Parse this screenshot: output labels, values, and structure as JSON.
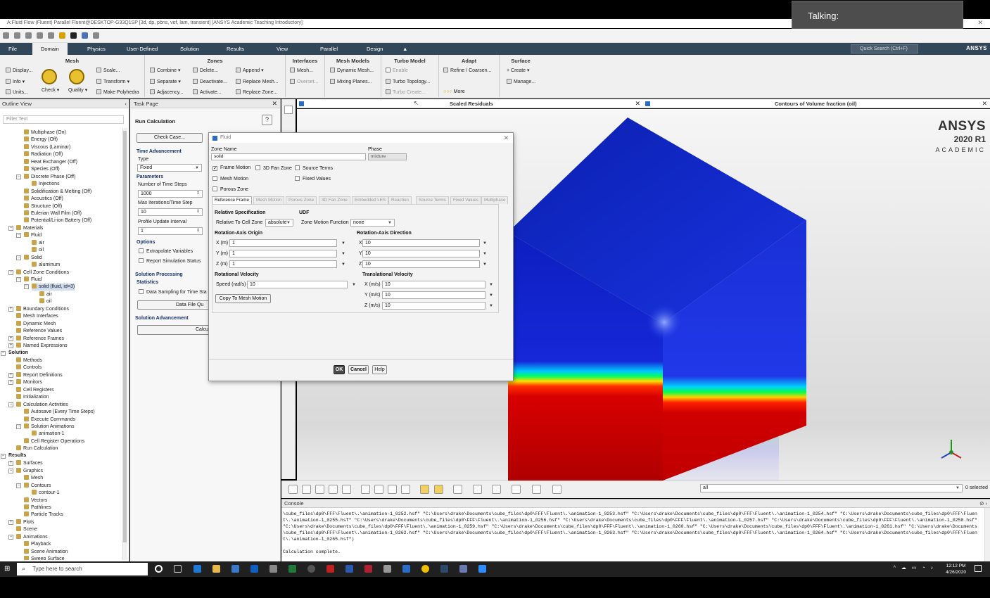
{
  "talking": "Talking:",
  "window_title": "A:Fluid Flow (Fluent) Parallel Fluent@DESKTOP-G33Q1SP  [3d, dp, pbns, vof, lam, transient] [ANSYS Academic Teaching Introductory]",
  "menu": {
    "file": "File",
    "domain": "Domain",
    "physics": "Physics",
    "user_defined": "User-Defined",
    "solution": "Solution",
    "results": "Results",
    "view": "View",
    "parallel": "Parallel",
    "design": "Design"
  },
  "quick_search": "Quick Search (Ctrl+F)",
  "ansys_logo": "ANSYS",
  "ribbon": {
    "mesh_title": "Mesh",
    "display": "Display...",
    "info": "Info",
    "units": "Units...",
    "check": "Check",
    "quality": "Quality",
    "scale": "Scale...",
    "transform": "Transform",
    "make_polyhedra": "Make Polyhedra",
    "zones_title": "Zones",
    "combine": "Combine",
    "separate": "Separate",
    "adjacency": "Adjacency...",
    "delete": "Delete...",
    "deactivate": "Deactivate...",
    "activate": "Activate...",
    "append": "Append",
    "replace_mesh": "Replace Mesh...",
    "replace_zone": "Replace Zone...",
    "interfaces_title": "Interfaces",
    "interfaces_mesh": "Mesh...",
    "overset": "Overset...",
    "mesh_models_title": "Mesh Models",
    "dynamic_mesh": "Dynamic Mesh...",
    "mixing_planes": "Mixing Planes...",
    "turbo_title": "Turbo Model",
    "enable": "Enable",
    "turbo_topology": "Turbo Topology...",
    "turbo_create": "Turbo Create...",
    "adapt_title": "Adapt",
    "refine_coarsen": "Refine / Coarsen...",
    "more": "More",
    "surface_title": "Surface",
    "create": "Create",
    "manage": "Manage..."
  },
  "outline": {
    "title": "Outline View",
    "filter_placeholder": "Filter Text",
    "items": [
      "Multiphase (On)",
      "Energy (Off)",
      "Viscous (Laminar)",
      "Radiation (Off)",
      "Heat Exchanger (Off)",
      "Species (Off)",
      "Discrete Phase (Off)",
      "Injections",
      "Solidification & Melting (Off)",
      "Acoustics (Off)",
      "Structure (Off)",
      "Eulerian Wall Film (Off)",
      "Potential/Li-ion Battery (Off)",
      "Materials",
      "Fluid",
      "air",
      "oil",
      "Solid",
      "aluminum",
      "Cell Zone Conditions",
      "Fluid",
      "solid (fluid, id=3)",
      "air",
      "oil",
      "Boundary Conditions",
      "Mesh Interfaces",
      "Dynamic Mesh",
      "Reference Values",
      "Reference Frames",
      "Named Expressions",
      "Solution",
      "Methods",
      "Controls",
      "Report Definitions",
      "Monitors",
      "Cell Registers",
      "Initialization",
      "Calculation Activities",
      "Autosave (Every Time Steps)",
      "Execute Commands",
      "Solution Animations",
      "animation-1",
      "Cell Register Operations",
      "Run Calculation",
      "Results",
      "Surfaces",
      "Graphics",
      "Mesh",
      "Contours",
      "contour-1",
      "Vectors",
      "Pathlines",
      "Particle Tracks",
      "Plots",
      "Scene",
      "Animations",
      "Playback",
      "Scene Animation",
      "Sweep Surface"
    ]
  },
  "task": {
    "header": "Task Page",
    "title": "Run Calculation",
    "check_case": "Check Case...",
    "time_advancement": "Time Advancement",
    "type_label": "Type",
    "type_value": "Fixed",
    "parameters": "Parameters",
    "num_steps_label": "Number of Time Steps",
    "num_steps_value": "1000",
    "max_iter_label": "Max Iterations/Time Step",
    "max_iter_value": "10",
    "profile_label": "Profile Update Interval",
    "profile_value": "1",
    "options": "Options",
    "extrapolate": "Extrapolate Variables",
    "report_sim": "Report Simulation Status",
    "solution_processing": "Solution Processing",
    "statistics": "Statistics",
    "data_sampling": "Data Sampling for Time Sta",
    "data_file": "Data File Qu",
    "solution_advancement": "Solution Advancement",
    "calculate": "Calcul"
  },
  "graphics": {
    "residuals_title": "Scaled Residuals",
    "contours_title": "Contours of Volume fraction (oil)",
    "brand_1": "ANSYS",
    "brand_2": "2020 R1",
    "brand_3": "ACADEMIC",
    "select_value": "all",
    "selected_count": "0 selected"
  },
  "console": {
    "title": "Console",
    "text": "\\cube_files\\dp0\\FFF\\Fluent\\.\\animation-1_0252.hsf\" \"C:\\Users\\drake\\Documents\\cube_files\\dp0\\FFF\\Fluent\\.\\animation-1_0253.hsf\" \"C:\\Users\\drake\\Documents\\cube_files\\dp0\\FFF\\Fluent\\.\\animation-1_0254.hsf\" \"C:\\Users\\drake\\Documents\\cube_files\\dp0\\FFF\\Fluent\\.\\animation-1_0255.hsf\" \"C:\\Users\\drake\\Documents\\cube_files\\dp0\\FFF\\Fluent\\.\\animation-1_0256.hsf\" \"C:\\Users\\drake\\Documents\\cube_files\\dp0\\FFF\\Fluent\\.\\animation-1_0257.hsf\" \"C:\\Users\\drake\\Documents\\cube_files\\dp0\\FFF\\Fluent\\.\\animation-1_0258.hsf\" \"C:\\Users\\drake\\Documents\\cube_files\\dp0\\FFF\\Fluent\\.\\animation-1_0259.hsf\" \"C:\\Users\\drake\\Documents\\cube_files\\dp0\\FFF\\Fluent\\.\\animation-1_0260.hsf\" \"C:\\Users\\drake\\Documents\\cube_files\\dp0\\FFF\\Fluent\\.\\animation-1_0261.hsf\" \"C:\\Users\\drake\\Documents\\cube_files\\dp0\\FFF\\Fluent\\.\\animation-1_0262.hsf\" \"C:\\Users\\drake\\Documents\\cube_files\\dp0\\FFF\\Fluent\\.\\animation-1_0263.hsf\" \"C:\\Users\\drake\\Documents\\cube_files\\dp0\\FFF\\Fluent\\.\\animation-1_0264.hsf\" \"C:\\Users\\drake\\Documents\\cube_files\\dp0\\FFF\\Fluent\\.\\animation-1_0265.hsf\")",
    "complete": "Calculation complete."
  },
  "dialog": {
    "title": "Fluid",
    "zone_name_label": "Zone Name",
    "zone_name_value": "solid",
    "phase_label": "Phase",
    "phase_value": "mixture",
    "frame_motion": "Frame Motion",
    "fan_zone": "3D Fan Zone",
    "source_terms": "Source Terms",
    "mesh_motion": "Mesh Motion",
    "fixed_values": "Fixed Values",
    "porous_zone": "Porous Zone",
    "tabs": [
      "Reference Frame",
      "Mesh Motion",
      "Porous Zone",
      "3D Fan Zone",
      "Embedded LES",
      "Reaction",
      "Source Terms",
      "Fixed Values",
      "Multiphase"
    ],
    "relative_spec": "Relative Specification",
    "relative_to_label": "Relative To Cell Zone",
    "relative_to_value": "absolute",
    "udf": "UDF",
    "zone_motion_label": "Zone Motion Function",
    "zone_motion_value": "none",
    "origin_title": "Rotation-Axis Origin",
    "x_m": "X (m)",
    "y_m": "Y (m)",
    "z_m": "Z (m)",
    "origin_x": "1",
    "origin_y": "1",
    "origin_z": "1",
    "direction_title": "Rotation-Axis Direction",
    "x": "X",
    "y": "Y",
    "z": "Z",
    "dir_x": "10",
    "dir_y": "10",
    "dir_z": "10",
    "rot_vel_title": "Rotational Velocity",
    "speed_label": "Speed (rad/s)",
    "speed_value": "10",
    "trans_vel_title": "Translational Velocity",
    "x_ms": "X (m/s)",
    "y_ms": "Y (m/s)",
    "z_ms": "Z (m/s)",
    "vel_x": "10",
    "vel_y": "10",
    "vel_z": "10",
    "copy_mesh": "Copy To Mesh Motion",
    "ok": "OK",
    "cancel": "Cancel",
    "help": "Help"
  },
  "taskbar": {
    "search": "Type here to search",
    "time": "12:12 PM",
    "date": "4/26/2020"
  },
  "colors": {
    "menubar": "#33475b",
    "cube_blue": "#1226c8",
    "cube_red": "#d40000",
    "dialog_bg": "#f3f3f3"
  }
}
